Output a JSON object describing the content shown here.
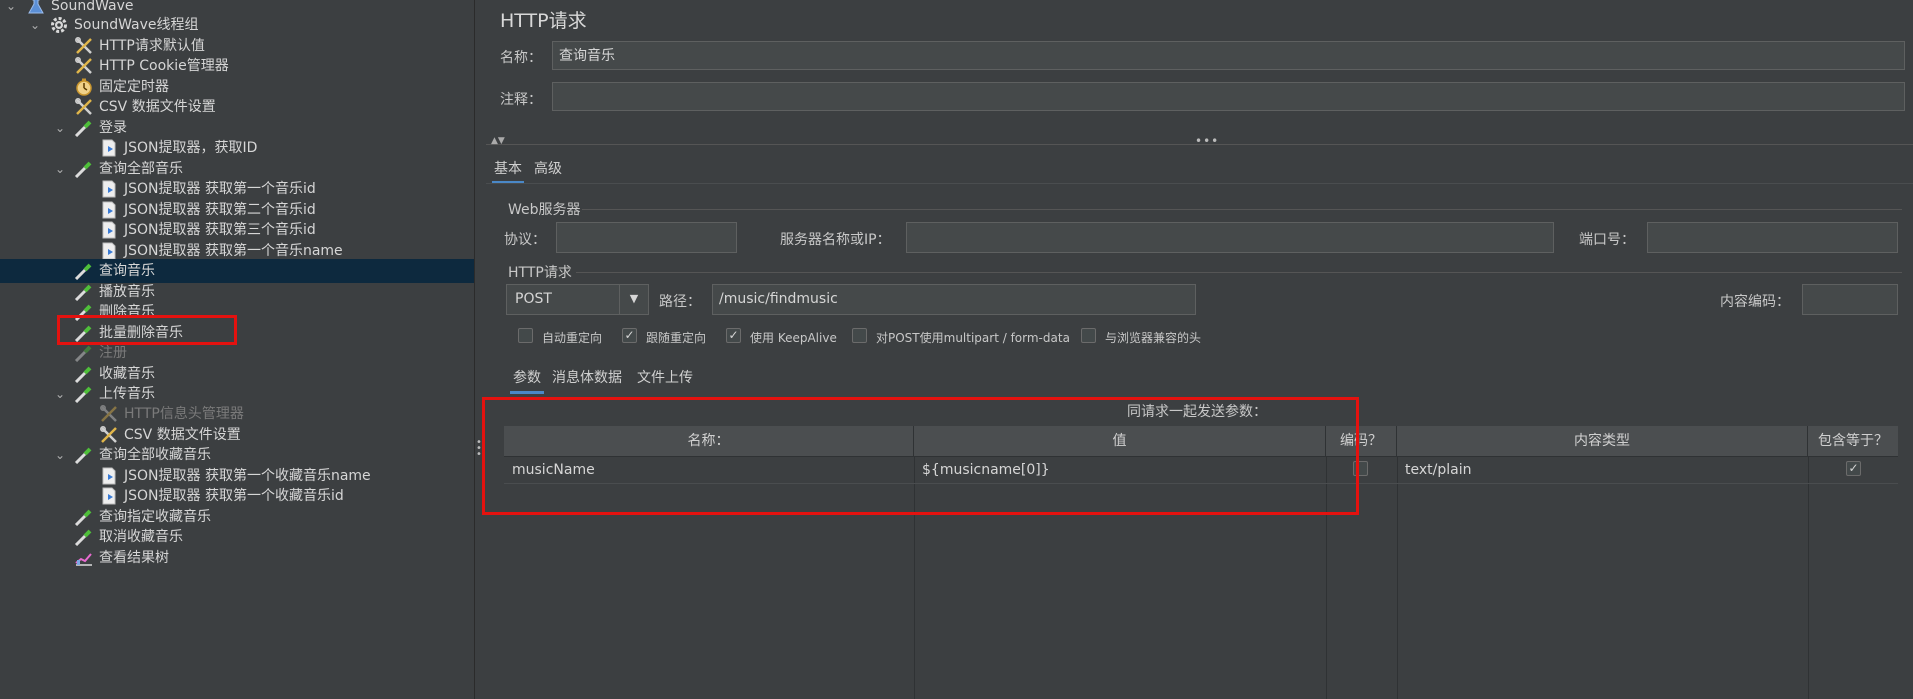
{
  "tree": {
    "items": [
      {
        "label": "SoundWave",
        "icon": "flask-icon",
        "depth": 0,
        "chev": "down"
      },
      {
        "label": "SoundWave线程组",
        "icon": "gear-icon",
        "depth": 1,
        "chev": "down"
      },
      {
        "label": "HTTP请求默认值",
        "icon": "wrench-icon",
        "depth": 2
      },
      {
        "label": "HTTP Cookie管理器",
        "icon": "wrench-icon",
        "depth": 2
      },
      {
        "label": "固定定时器",
        "icon": "timer-icon",
        "depth": 2
      },
      {
        "label": "CSV 数据文件设置",
        "icon": "wrench-icon",
        "depth": 2
      },
      {
        "label": "登录",
        "icon": "pipette-icon",
        "depth": 2,
        "chev": "down"
      },
      {
        "label": "JSON提取器，获取ID",
        "icon": "doc-icon",
        "depth": 3
      },
      {
        "label": "查询全部音乐",
        "icon": "pipette-icon",
        "depth": 2,
        "chev": "down"
      },
      {
        "label": "JSON提取器 获取第一个音乐id",
        "icon": "doc-icon",
        "depth": 3
      },
      {
        "label": "JSON提取器 获取第二个音乐id",
        "icon": "doc-icon",
        "depth": 3
      },
      {
        "label": "JSON提取器 获取第三个音乐id",
        "icon": "doc-icon",
        "depth": 3
      },
      {
        "label": "JSON提取器 获取第一个音乐name",
        "icon": "doc-icon",
        "depth": 3
      },
      {
        "label": "查询音乐",
        "icon": "pipette-icon",
        "depth": 2,
        "selected": true
      },
      {
        "label": "播放音乐",
        "icon": "pipette-icon",
        "depth": 2
      },
      {
        "label": "删除音乐",
        "icon": "pipette-icon",
        "depth": 2
      },
      {
        "label": "批量删除音乐",
        "icon": "pipette-icon",
        "depth": 2
      },
      {
        "label": "注册",
        "icon": "pipette-icon",
        "depth": 2,
        "disabled": true
      },
      {
        "label": "收藏音乐",
        "icon": "pipette-icon",
        "depth": 2
      },
      {
        "label": "上传音乐",
        "icon": "pipette-icon",
        "depth": 2,
        "chev": "down"
      },
      {
        "label": "HTTP信息头管理器",
        "icon": "wrench-icon",
        "depth": 3,
        "disabled": true
      },
      {
        "label": "CSV 数据文件设置",
        "icon": "wrench-icon",
        "depth": 3
      },
      {
        "label": "查询全部收藏音乐",
        "icon": "pipette-icon",
        "depth": 2,
        "chev": "down"
      },
      {
        "label": "JSON提取器 获取第一个收藏音乐name",
        "icon": "doc-icon",
        "depth": 3
      },
      {
        "label": "JSON提取器 获取第一个收藏音乐id",
        "icon": "doc-icon",
        "depth": 3
      },
      {
        "label": "查询指定收藏音乐",
        "icon": "pipette-icon",
        "depth": 2
      },
      {
        "label": "取消收藏音乐",
        "icon": "pipette-icon",
        "depth": 2
      },
      {
        "label": "查看结果树",
        "icon": "chart-icon",
        "depth": 2
      }
    ]
  },
  "panel": {
    "title": "HTTP请求",
    "name_label": "名称：",
    "name_value": "查询音乐",
    "comment_label": "注释：",
    "comment_value": ""
  },
  "tabs": {
    "basic": "基本",
    "advanced": "高级"
  },
  "web_server": {
    "section": "Web服务器",
    "protocol_label": "协议：",
    "protocol_value": "",
    "server_label": "服务器名称或IP：",
    "server_value": "",
    "port_label": "端口号：",
    "port_value": ""
  },
  "http_request": {
    "section": "HTTP请求",
    "method": "POST",
    "path_label": "路径：",
    "path_value": "/music/findmusic",
    "encoding_label": "内容编码：",
    "encoding_value": ""
  },
  "options": [
    {
      "label": "自动重定向",
      "checked": false
    },
    {
      "label": "跟随重定向",
      "checked": true
    },
    {
      "label": "使用 KeepAlive",
      "checked": true
    },
    {
      "label": "对POST使用multipart / form-data",
      "checked": false
    },
    {
      "label": "与浏览器兼容的头",
      "checked": false
    }
  ],
  "subtabs": {
    "params": "参数",
    "body": "消息体数据",
    "files": "文件上传"
  },
  "params_table": {
    "caption": "同请求一起发送参数：",
    "headers": {
      "name": "名称：",
      "value": "值",
      "encode": "编码？",
      "content_type": "内容类型",
      "include_equals": "包含等于？"
    },
    "rows": [
      {
        "name": "musicName",
        "value": "${musicname[0]}",
        "encode": false,
        "content_type": "text/plain",
        "include_equals": true
      }
    ]
  },
  "check_mark": "✓",
  "colors": {
    "highlight": "#e4120f",
    "selection": "#0d293e",
    "tab_underline": "#4a88c7"
  }
}
